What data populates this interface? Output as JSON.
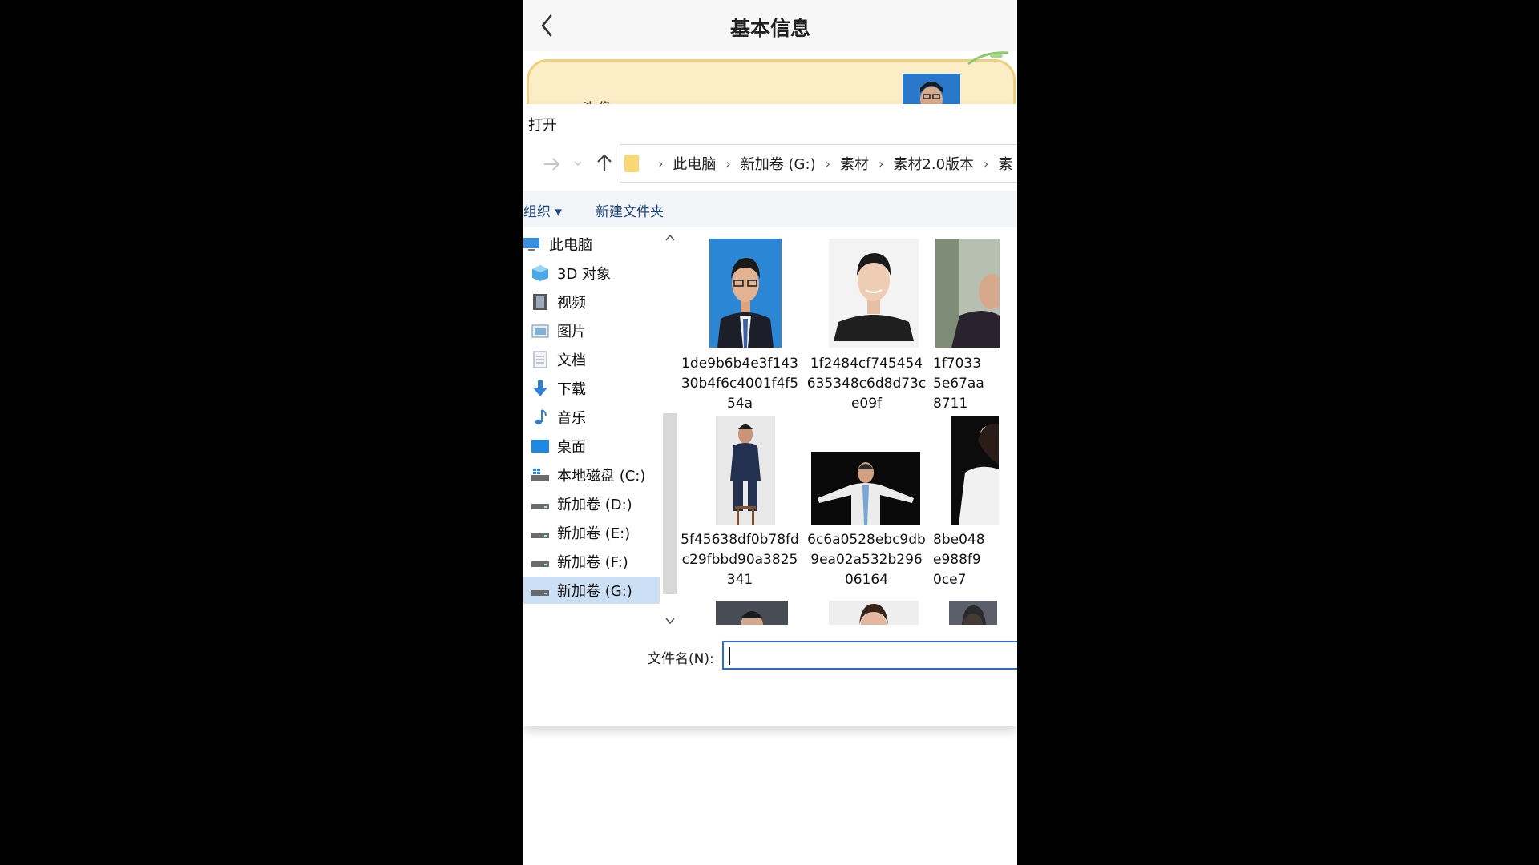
{
  "app": {
    "title": "基本信息",
    "card_label": "头像"
  },
  "dialog": {
    "title": "打开",
    "breadcrumb": [
      "此电脑",
      "新加卷 (G:)",
      "素材",
      "素材2.0版本",
      "素"
    ],
    "toolbar": {
      "organize": "组织 ▾",
      "new_folder": "新建文件夹"
    },
    "nav_items": [
      {
        "label": "此电脑",
        "icon": "computer-icon"
      },
      {
        "label": "3D 对象",
        "icon": "3d-objects-icon"
      },
      {
        "label": "视频",
        "icon": "video-icon"
      },
      {
        "label": "图片",
        "icon": "pictures-icon"
      },
      {
        "label": "文档",
        "icon": "documents-icon"
      },
      {
        "label": "下载",
        "icon": "download-icon"
      },
      {
        "label": "音乐",
        "icon": "music-icon"
      },
      {
        "label": "桌面",
        "icon": "desktop-icon"
      },
      {
        "label": "本地磁盘 (C:)",
        "icon": "local-disk-icon"
      },
      {
        "label": "新加卷 (D:)",
        "icon": "drive-icon"
      },
      {
        "label": "新加卷 (E:)",
        "icon": "drive-icon"
      },
      {
        "label": "新加卷 (F:)",
        "icon": "drive-icon"
      },
      {
        "label": "新加卷 (G:)",
        "icon": "drive-icon",
        "selected": true
      }
    ],
    "files": [
      {
        "name": "1de9b6b4e3f14330b4f6c4001f4f554a"
      },
      {
        "name": "1f2484cf745454635348c6d8d73ce09f"
      },
      {
        "name": "1f70335e67aa8711"
      },
      {
        "name": "5f45638df0b78fdc29fbbd90a3825341"
      },
      {
        "name": "6c6a0528ebc9db9ea02a532b29606164"
      },
      {
        "name": "8be048e988f90ce7"
      }
    ],
    "filename_label": "文件名(N):",
    "filename_value": ""
  },
  "colors": {
    "accent": "#2b6cd0",
    "card_bg": "#fbedc5",
    "card_border": "#f0cf7a",
    "selection": "#cce0f5",
    "link": "#1e4a83"
  }
}
